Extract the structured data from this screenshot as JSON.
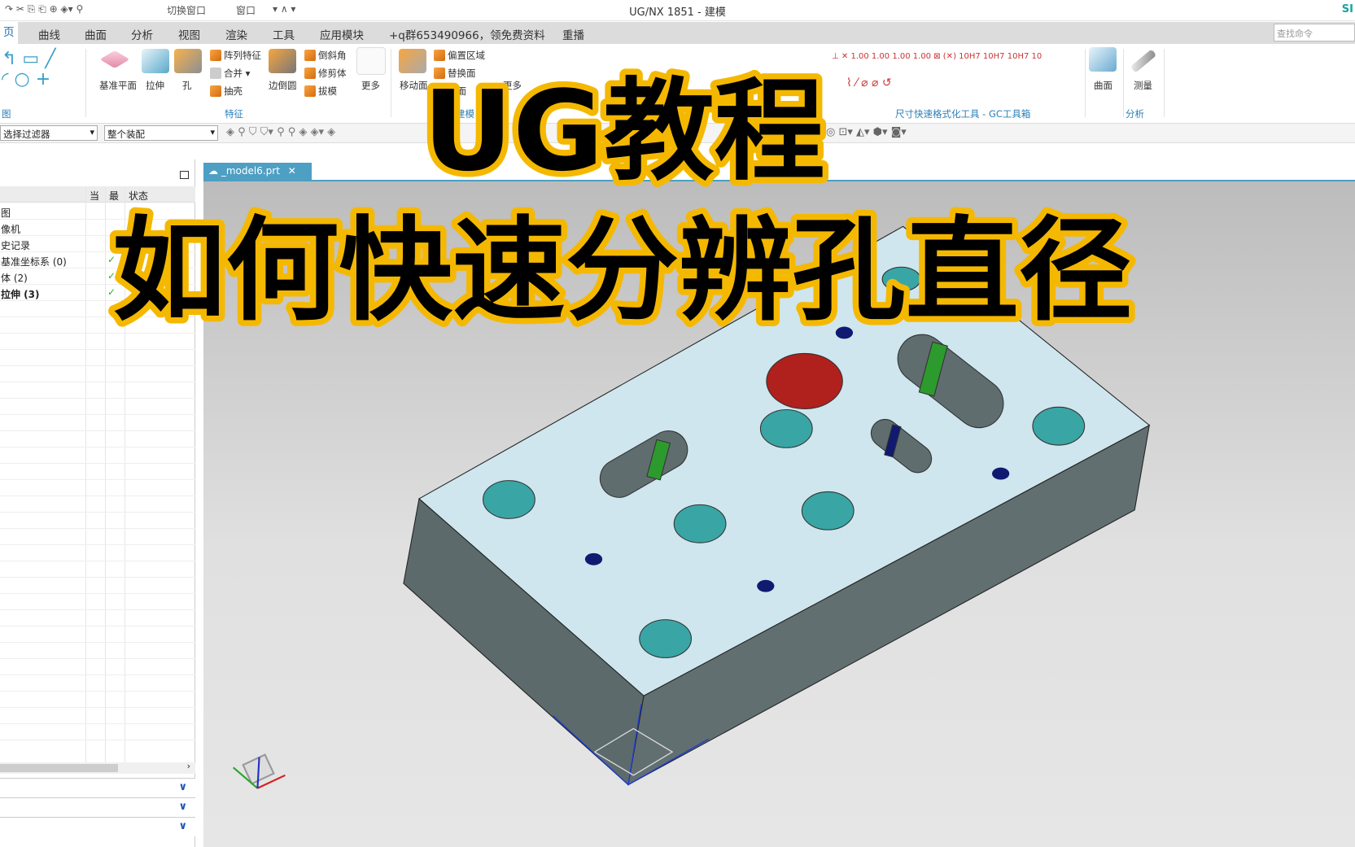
{
  "window": {
    "title": "UG/NX 1851 - 建模",
    "brand": "SI"
  },
  "quick_access": {
    "switch_window": "切换窗口",
    "window_menu": "窗口"
  },
  "tabs": [
    "页",
    "曲线",
    "曲面",
    "分析",
    "视图",
    "渲染",
    "工具",
    "应用模块",
    "+q群653490966，领免费资料",
    "重播"
  ],
  "command_search": {
    "placeholder": "查找命令"
  },
  "ribbon": {
    "sketch_group": "图",
    "feature": {
      "datum_plane": "基准平面",
      "extrude": "拉伸",
      "hole": "孔",
      "pattern": "阵列特征",
      "unite": "合并",
      "shell": "抽壳",
      "edge_blend": "边倒圆",
      "chamfer": "倒斜角",
      "trim_body": "修剪体",
      "draft": "拔模",
      "more": "更多",
      "group": "特征"
    },
    "sync": {
      "move_face": "移动面",
      "offset_region": "偏置区域",
      "replace_face": "替换面",
      "delete_face": "除面",
      "more": "更多",
      "group": "建模"
    },
    "gc_group": "尺寸快速格式化工具 - GC工具箱",
    "surface": "曲面",
    "measure": "测量",
    "analysis_group": "分析"
  },
  "filter": {
    "type_filter": "选择过滤器",
    "scope": "整个装配"
  },
  "navigator": {
    "columns": [
      "当",
      "最",
      "状态"
    ],
    "rows": [
      {
        "label": "图",
        "check": false,
        "bold": false
      },
      {
        "label": "像机",
        "check": false,
        "bold": false
      },
      {
        "label": "史记录",
        "check": false,
        "bold": false
      },
      {
        "label": "基准坐标系 (0)",
        "check": true,
        "bold": false
      },
      {
        "label": "体 (2)",
        "check": true,
        "bold": false
      },
      {
        "label": "拉伸 (3)",
        "check": true,
        "bold": true
      }
    ]
  },
  "document": {
    "tab_label": "_model6.prt"
  },
  "overlay": {
    "title": "UG教程",
    "subtitle": "如何快速分辨孔直径"
  },
  "colors": {
    "accent": "#4e9fc4",
    "top_face": "#cfe6ee",
    "side_face": "#5f6d6f",
    "hole_teal": "#3aa5a5",
    "hole_red": "#b0201c",
    "slot_green": "#2d9a2d",
    "overlay_text": "#000000",
    "overlay_stroke": "#f5b800"
  }
}
